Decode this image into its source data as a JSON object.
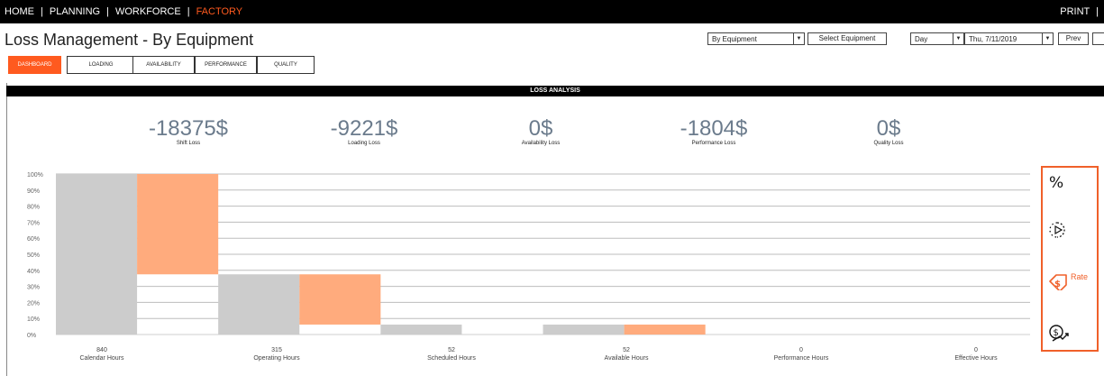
{
  "nav": {
    "items": [
      "HOME",
      "PLANNING",
      "WORKFORCE",
      "FACTORY"
    ],
    "active": "FACTORY",
    "print": "PRINT"
  },
  "page": {
    "title": "Loss Management - By Equipment"
  },
  "controls": {
    "view_select": "By Equipment",
    "select_equipment": "Select Equipment",
    "period_select": "Day",
    "date_select": "Thu, 7/11/2019",
    "prev": "Prev"
  },
  "tabs": [
    {
      "label": "DASHBOARD",
      "active": true
    },
    {
      "label": "LOADING",
      "active": false
    },
    {
      "label": "AVAILABILITY",
      "active": false
    },
    {
      "label": "PERFORMANCE",
      "active": false
    },
    {
      "label": "QUALITY",
      "active": false
    }
  ],
  "panel": {
    "header": "LOSS ANALYSIS"
  },
  "kpis": [
    {
      "value": "-18375$",
      "label": "Shift Loss"
    },
    {
      "value": "-9221$",
      "label": "Loading Loss"
    },
    {
      "value": "0$",
      "label": "Availability Loss"
    },
    {
      "value": "-1804$",
      "label": "Performance Loss"
    },
    {
      "value": "0$",
      "label": "Quality Loss"
    }
  ],
  "side_panel": {
    "items": [
      {
        "icon": "percent-icon",
        "label": ""
      },
      {
        "icon": "timer-icon",
        "label": ""
      },
      {
        "icon": "dollar-tag-icon",
        "label": "Rate"
      },
      {
        "icon": "dollar-trend-icon",
        "label": ""
      }
    ],
    "accent": "#f0602a"
  },
  "colors": {
    "accent": "#ff5a1f",
    "bar_gray": "#cccccc",
    "bar_orange": "#ffab7d",
    "kpi_value": "#6b7b8c"
  },
  "chart_data": {
    "type": "bar",
    "ylim": [
      0,
      100
    ],
    "y_ticks": [
      "0%",
      "10%",
      "20%",
      "30%",
      "40%",
      "50%",
      "60%",
      "70%",
      "80%",
      "90%",
      "100%"
    ],
    "grid": true,
    "categories": [
      "Calendar Hours",
      "Operating Hours",
      "Scheduled Hours",
      "Available Hours",
      "Performance Hours",
      "Effective Hours"
    ],
    "category_values": [
      "840",
      "315",
      "52",
      "52",
      "0",
      "0"
    ],
    "series": [
      {
        "values": [
          100,
          37.5,
          6.2,
          6.2,
          0,
          0
        ]
      },
      {
        "values": [
          {
            "from": 37.5,
            "to": 100
          },
          {
            "from": 6.2,
            "to": 37.5
          },
          {
            "from": 0,
            "to": 0
          },
          {
            "from": 0,
            "to": 6.2
          },
          {
            "from": 0,
            "to": 0
          },
          {
            "from": 0,
            "to": 0
          }
        ]
      }
    ]
  }
}
